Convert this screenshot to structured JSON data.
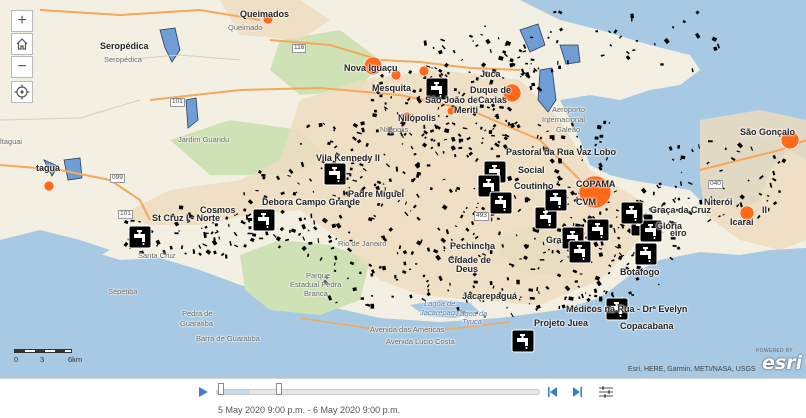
{
  "map": {
    "attribution": "Esri, HERE, Garmin, METI/NASA, USGS",
    "powered_by": "POWERED BY",
    "esri_logo": "esri",
    "colors": {
      "land": "#f3f0e3",
      "urban": "#ecdcc0",
      "park": "#cfe2b5",
      "water": "#a7c9e3",
      "polygon": "#6f9ed6",
      "major_road": "#f4a85a",
      "incident_marker": "#ff6a1a",
      "feature": "#000000"
    },
    "places": [
      {
        "id": "queimados",
        "text": "Queimados",
        "bold": true
      },
      {
        "id": "queimada",
        "text": "Queimado",
        "gray": true
      },
      {
        "id": "seropedica-b",
        "text": "Seropédica",
        "bold": true
      },
      {
        "id": "seropedica",
        "text": "Seropédica",
        "gray": true
      },
      {
        "id": "nova-iguacu",
        "text": "Nova Iguaçu",
        "bold": true
      },
      {
        "id": "mesquita",
        "text": "Mesquita",
        "bold": true
      },
      {
        "id": "joao-meriti",
        "text": "São João de",
        "bold": true
      },
      {
        "id": "meriti",
        "text": "Meriti",
        "bold": true
      },
      {
        "id": "nilopolis-b",
        "text": "Nilópolis",
        "bold": true
      },
      {
        "id": "nilopolis",
        "text": "Nilópolis",
        "gray": true
      },
      {
        "id": "duque",
        "text": "Duque de",
        "bold": true
      },
      {
        "id": "caxias",
        "text": "Caxias",
        "bold": true
      },
      {
        "id": "jucaj",
        "text": "Juca",
        "bold": true
      },
      {
        "id": "aeroporto",
        "text": "Aeroporto",
        "gray": true
      },
      {
        "id": "internacional",
        "text": "Internacional",
        "gray": true
      },
      {
        "id": "galeao",
        "text": "Galeão",
        "gray": true
      },
      {
        "id": "sao-goncalo",
        "text": "São Gonçalo",
        "bold": true
      },
      {
        "id": "itaguai",
        "text": "ltaguai",
        "gray": true
      },
      {
        "id": "itagua-b",
        "text": "tagua",
        "bold": true
      },
      {
        "id": "jardim-guandu",
        "text": "Jardim Guandu",
        "gray": true
      },
      {
        "id": "vila-kennedy",
        "text": "Vila Kennedy II",
        "bold": true
      },
      {
        "id": "pastoral",
        "text": "Pastoral da Rua Vaz Lobo",
        "bold": true
      },
      {
        "id": "social",
        "text": "Social",
        "bold": true
      },
      {
        "id": "coutinho",
        "text": "Coutinho",
        "bold": true
      },
      {
        "id": "padre-miguel",
        "text": "Padre Miguel",
        "bold": true
      },
      {
        "id": "campo-grande",
        "text": "Debora Campo Grande",
        "bold": true
      },
      {
        "id": "cosmos",
        "text": "Cosmos",
        "bold": true
      },
      {
        "id": "cruz-norte",
        "text": "St Cruz I - Norte",
        "bold": true
      },
      {
        "id": "santa-cruz",
        "text": "Santa Cruz",
        "gray": true
      },
      {
        "id": "rio",
        "text": "Rio de Janeiro",
        "gray": true
      },
      {
        "id": "pechincha",
        "text": "Pechincha",
        "bold": true
      },
      {
        "id": "cidade-deus",
        "text": "Cidade de",
        "bold": true
      },
      {
        "id": "deus",
        "text": "Deus",
        "bold": true
      },
      {
        "id": "jacarepagua",
        "text": "Jacarepaguá",
        "bold": true
      },
      {
        "id": "lagoa",
        "text": "Lagoa de",
        "water": true
      },
      {
        "id": "jacarepagua-w",
        "text": "Jacarepaguá",
        "water": true
      },
      {
        "id": "tijuca-l",
        "text": "Lagoa da",
        "water": true
      },
      {
        "id": "tijuca",
        "text": "Tijuca",
        "water": true
      },
      {
        "id": "americas",
        "text": "Avenida das Américas",
        "gray": true
      },
      {
        "id": "lucio-costa",
        "text": "Avenida Lucio Costa",
        "gray": true
      },
      {
        "id": "projeto",
        "text": "Projeto Juea",
        "bold": true
      },
      {
        "id": "medicos",
        "text": "Médicos na Rua - Drª Evelyn",
        "bold": true
      },
      {
        "id": "copacabana",
        "text": "Copacabana",
        "bold": true
      },
      {
        "id": "botafogo",
        "text": "Botafogo",
        "bold": true
      },
      {
        "id": "copama",
        "text": "COPAMA",
        "bold": true
      },
      {
        "id": "cvm",
        "text": "CVM",
        "bold": true
      },
      {
        "id": "niteroi",
        "text": "Niterói",
        "bold": true
      },
      {
        "id": "graca-cruz",
        "text": "Graça da Cruz",
        "bold": true
      },
      {
        "id": "gloria",
        "text": "Glória",
        "bold": true
      },
      {
        "id": "ieiro",
        "text": "eiro",
        "bold": true
      },
      {
        "id": "ll",
        "text": "ll",
        "bold": true
      },
      {
        "id": "icarai",
        "text": "Icaraí",
        "bold": true
      },
      {
        "id": "gra",
        "text": "Gra",
        "bold": true
      },
      {
        "id": "parque",
        "text": "Parque",
        "gray": true
      },
      {
        "id": "estadual",
        "text": "Estadual Pedra",
        "gray": true
      },
      {
        "id": "branca",
        "text": "Branca",
        "gray": true
      },
      {
        "id": "sepetiba",
        "text": "Sepetiba",
        "gray": true
      },
      {
        "id": "pedra",
        "text": "Pedra de",
        "gray": true
      },
      {
        "id": "guaratiba",
        "text": "Guaratiba",
        "gray": true
      },
      {
        "id": "barra-guaratiba",
        "text": "Barra de Guaratiba",
        "gray": true
      }
    ],
    "roads": [
      "116",
      "101",
      "101",
      "099",
      "493",
      "040"
    ],
    "scale": {
      "labels": [
        "0",
        "3",
        "6km"
      ]
    }
  },
  "controls": {
    "zoom_in": "+",
    "zoom_out": "−"
  },
  "timeline": {
    "time_extent": "5 May 2020 9:00 p.m. - 6 May 2020 9:00 p.m.",
    "slider_start_fraction": 0.0,
    "slider_end_fraction": 0.1
  }
}
